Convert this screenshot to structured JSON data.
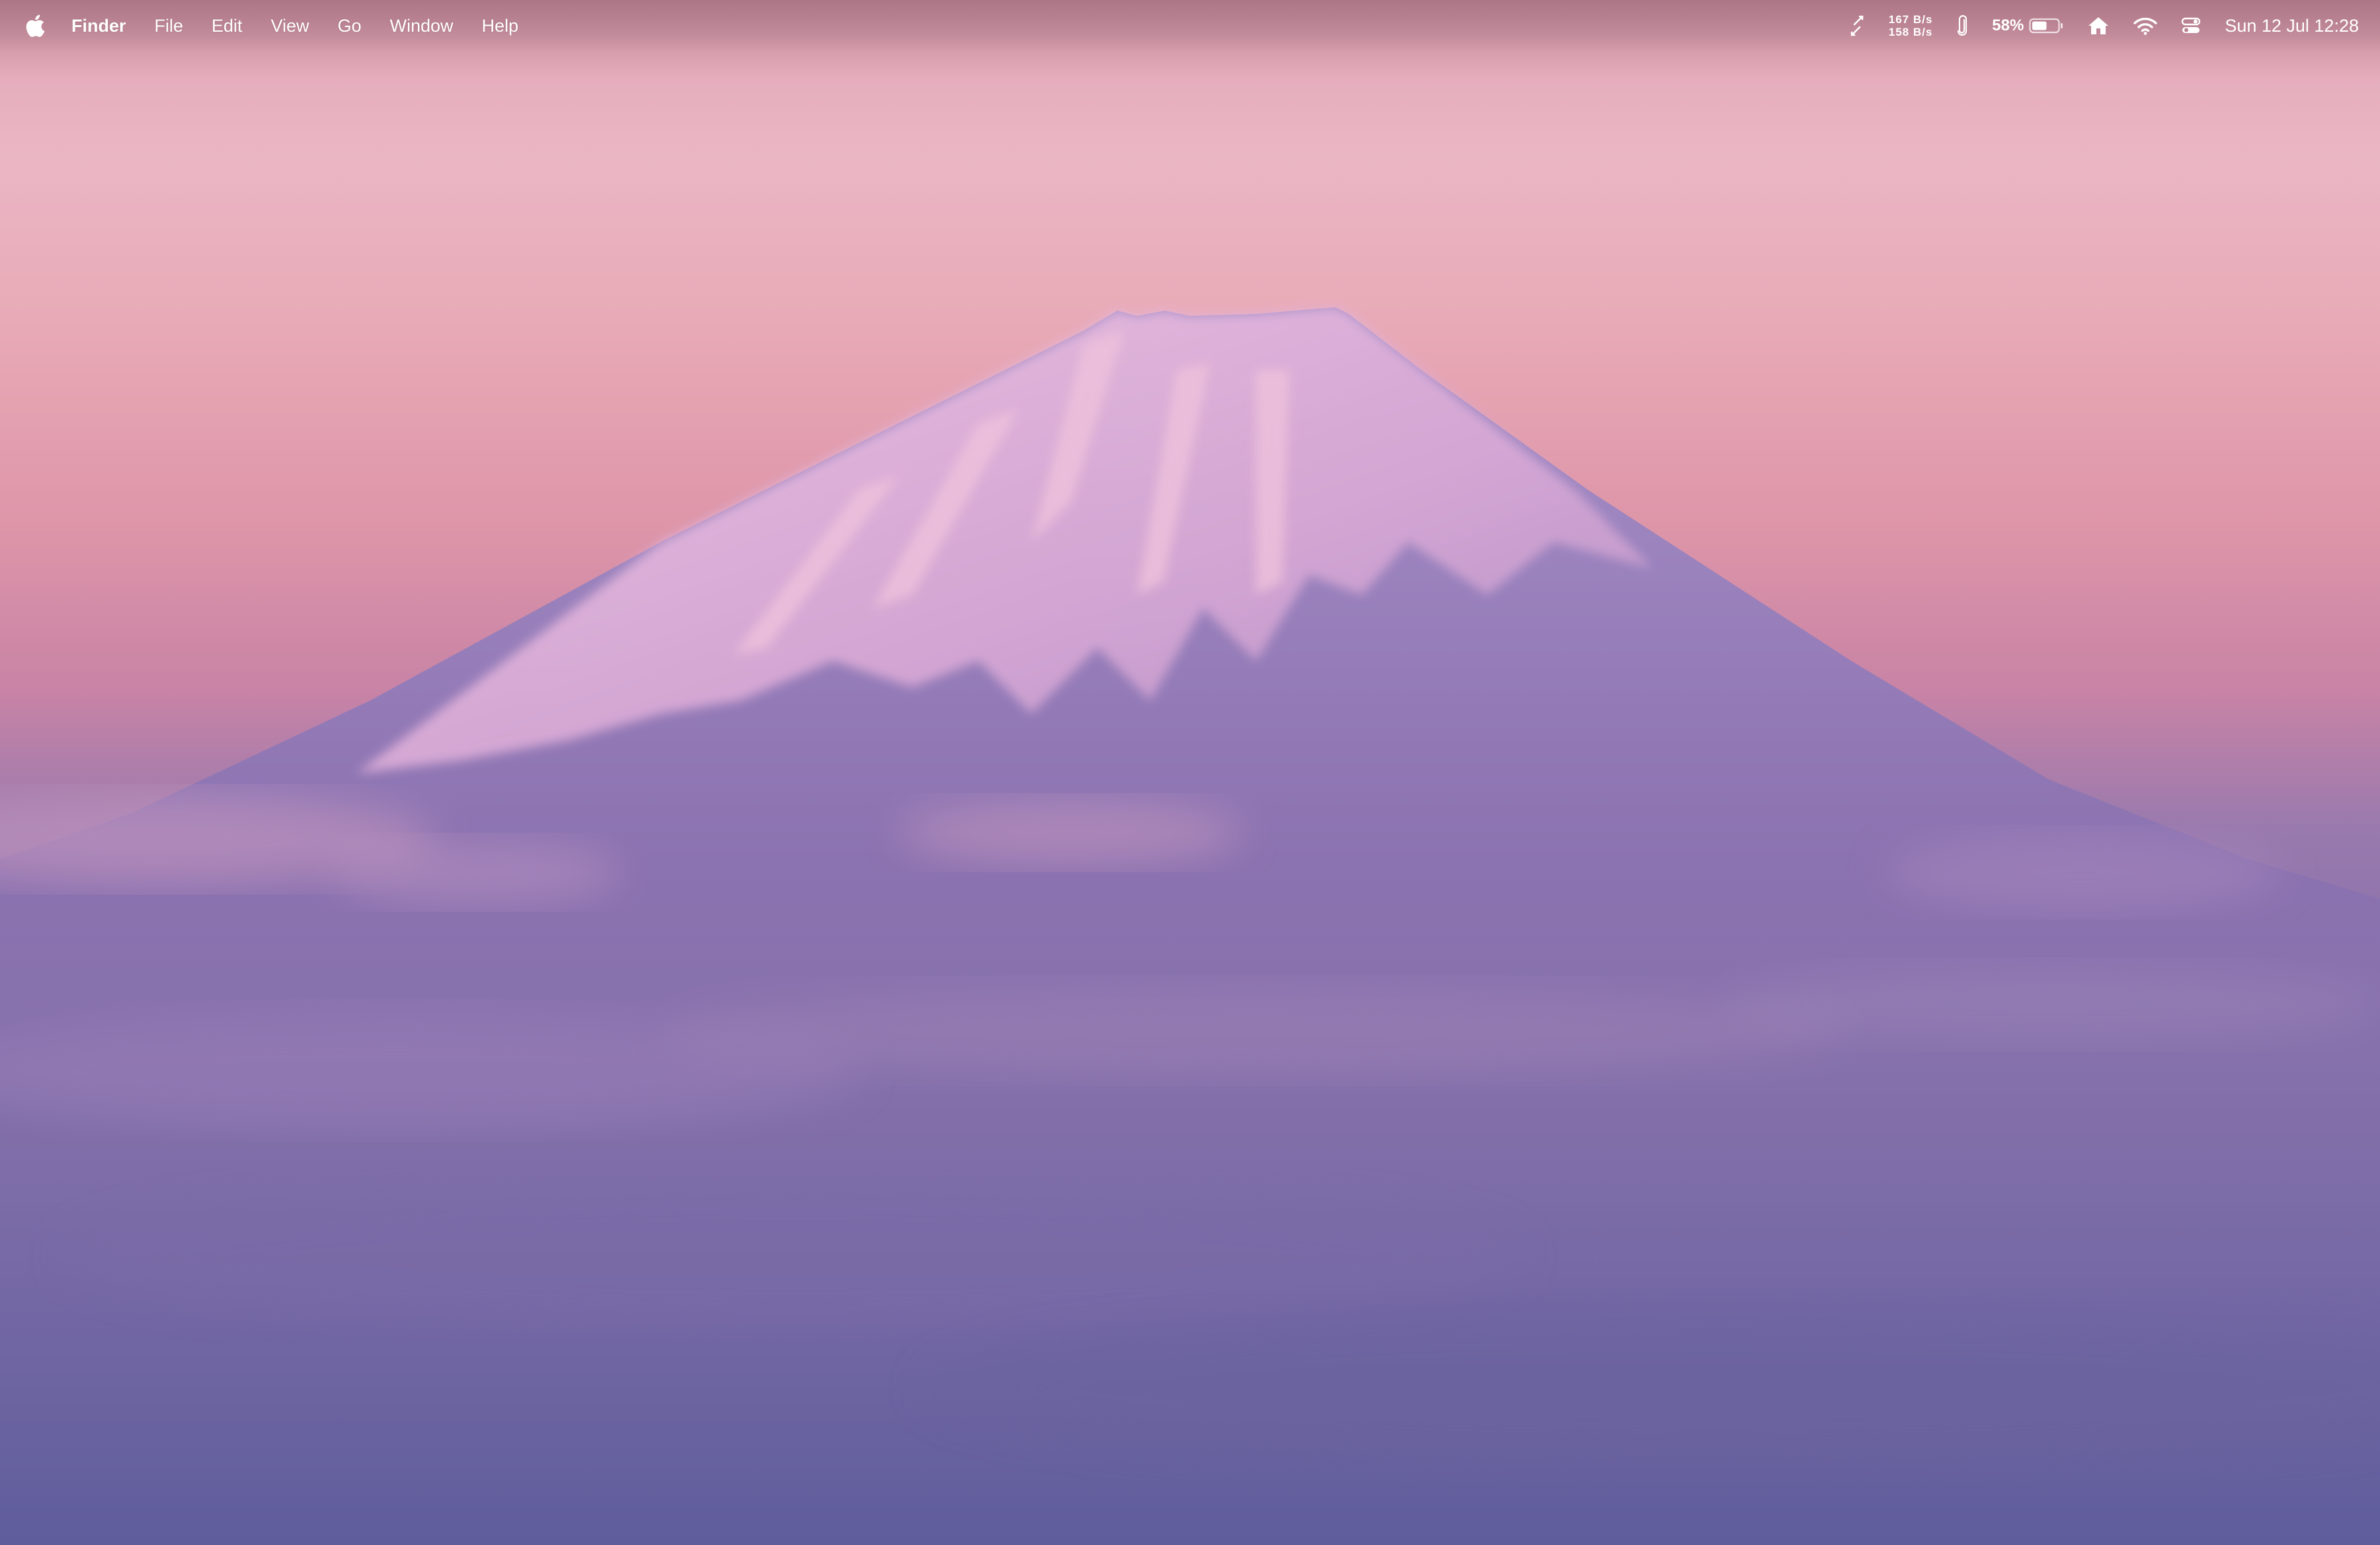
{
  "menubar": {
    "app_name": "Finder",
    "menus": [
      "File",
      "Edit",
      "View",
      "Go",
      "Window",
      "Help"
    ],
    "status": {
      "net_up": "167 B/s",
      "net_down": "158 B/s",
      "battery_percent": "58%",
      "battery_level": 0.58,
      "datetime": "Sun 12 Jul  12:28"
    },
    "icons": [
      "apple-icon",
      "sync-arrows-icon",
      "paperclip-icon",
      "battery-icon",
      "home-icon",
      "wifi-icon",
      "control-center-icon"
    ]
  },
  "desktop": {
    "wallpaper": "mountain-at-dusk",
    "colors": {
      "sky_top": "#ebb6c4",
      "sky_horizon": "#dd95a8",
      "mountain": "#8b72b0",
      "snow": "#e4b4d4",
      "clouds": "#7c6ca6",
      "bottom": "#5f5d9c"
    }
  }
}
